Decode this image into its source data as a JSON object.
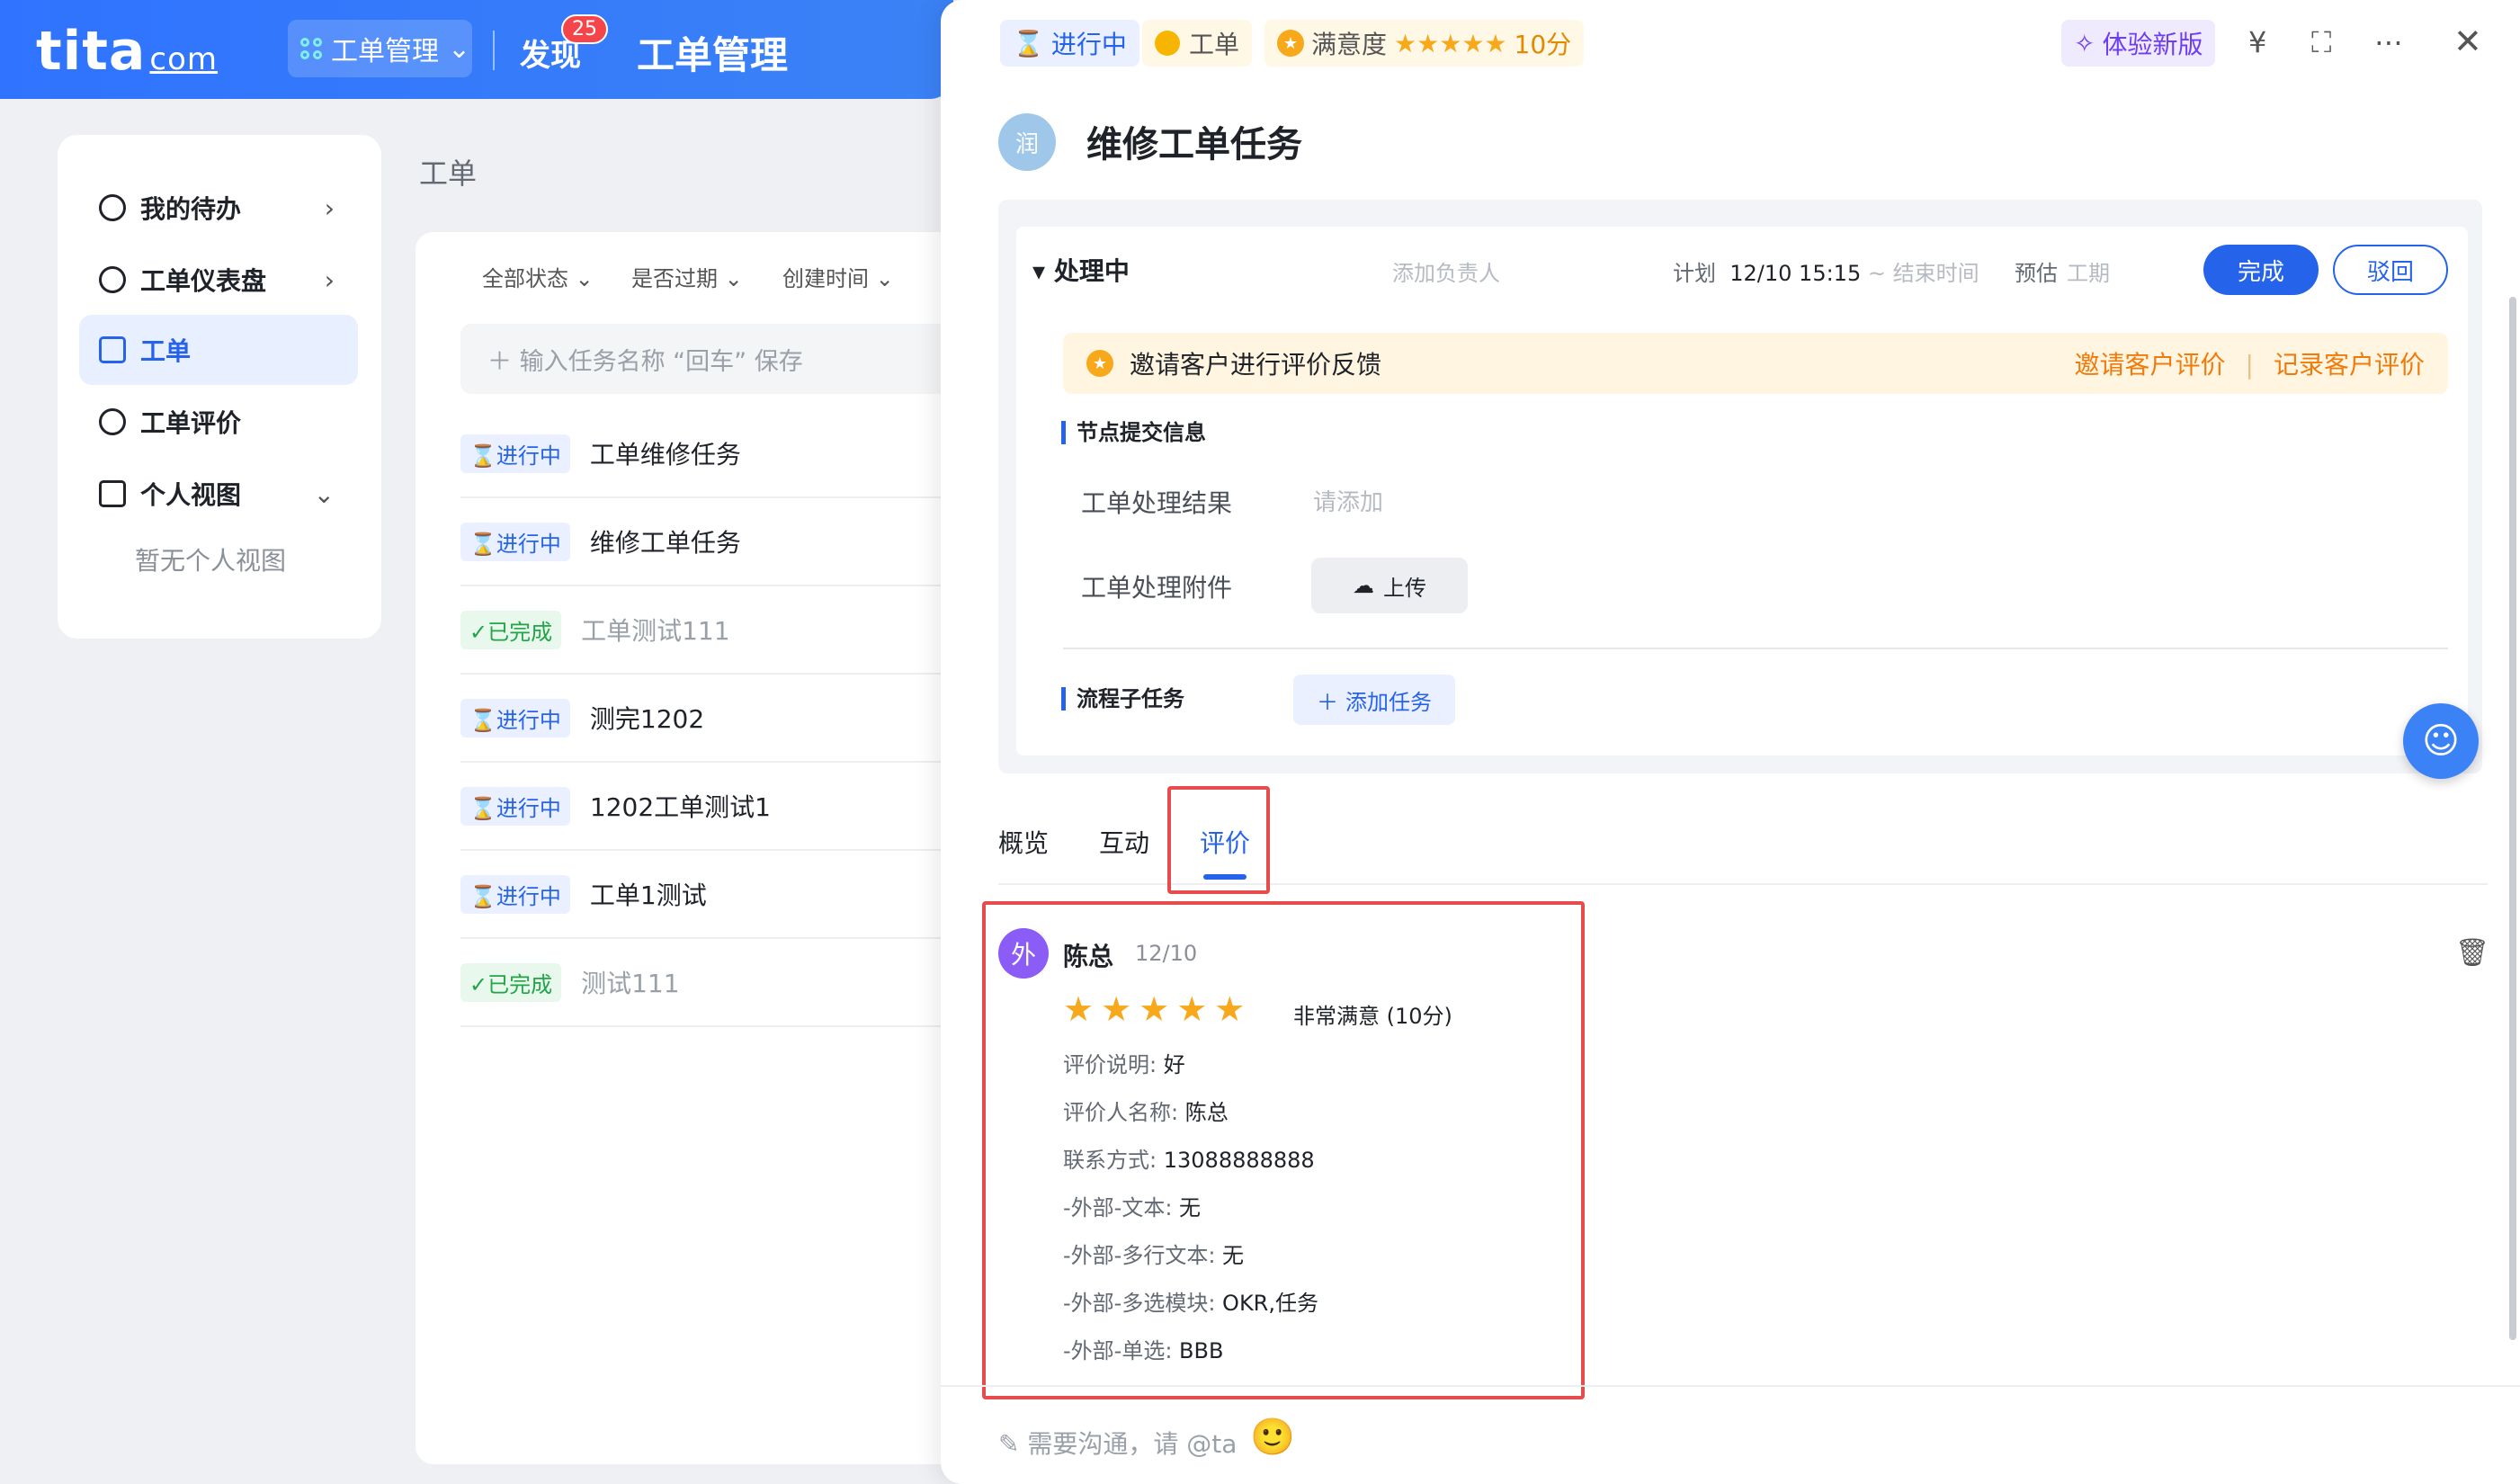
{
  "topbar": {
    "logo": "tita",
    "logo_suffix": "com",
    "module": "工单管理",
    "discover": "发现",
    "discover_badge": "25",
    "title": "工单管理"
  },
  "sidebar": {
    "items": [
      {
        "label": "我的待办",
        "icon": "check-circle-icon"
      },
      {
        "label": "工单仪表盘",
        "icon": "gauge-icon"
      },
      {
        "label": "工单",
        "icon": "document-icon"
      },
      {
        "label": "工单评价",
        "icon": "star-badge-icon"
      },
      {
        "label": "个人视图",
        "icon": "grid-icon"
      }
    ],
    "empty_view": "暂无个人视图"
  },
  "list": {
    "title": "工单",
    "filters": [
      "全部状态",
      "是否过期",
      "创建时间"
    ],
    "new_task_placeholder": "＋ 输入任务名称 “回车” 保存",
    "tasks": [
      {
        "status": "进行中",
        "name": "工单维修任务"
      },
      {
        "status": "进行中",
        "name": "维修工单任务"
      },
      {
        "status": "已完成",
        "name": "工单测试111"
      },
      {
        "status": "进行中",
        "name": "测完1202"
      },
      {
        "status": "进行中",
        "name": "1202工单测试1"
      },
      {
        "status": "进行中",
        "name": "工单1测试"
      },
      {
        "status": "已完成",
        "name": "测试111"
      }
    ]
  },
  "detail": {
    "status": "进行中",
    "type": "工单",
    "satisfaction_label": "满意度",
    "satisfaction_score": "10分",
    "satisfaction_stars": 5,
    "try_new": "体验新版",
    "avatar": "润",
    "title": "维修工单任务",
    "node": {
      "title": "处理中",
      "add_owner": "添加负责人",
      "plan_label": "计划",
      "plan_time": "12/10 15:15",
      "plan_end": "~ 结束时间",
      "estimate_label": "预估",
      "estimate_value": "工期",
      "btn_done": "完成",
      "btn_reject": "驳回",
      "invite_text": "邀请客户进行评价反馈",
      "invite_action": "邀请客户评价",
      "record_action": "记录客户评价",
      "section_submit": "节点提交信息",
      "field_result": "工单处理结果",
      "field_result_placeholder": "请添加",
      "field_attachment": "工单处理附件",
      "upload": "上传",
      "section_subtask": "流程子任务",
      "add_subtask": "添加任务"
    },
    "tabs": [
      "概览",
      "互动",
      "评价"
    ],
    "active_tab": "评价",
    "review": {
      "avatar": "外",
      "name": "陈总",
      "date": "12/10",
      "stars": 5,
      "level": "非常满意 (10分)",
      "fields": [
        {
          "label": "评价说明:",
          "value": "好"
        },
        {
          "label": "评价人名称:",
          "value": "陈总"
        },
        {
          "label": "联系方式:",
          "value": "13088888888"
        },
        {
          "label": "-外部-文本:",
          "value": "无"
        },
        {
          "label": "-外部-多行文本:",
          "value": "无"
        },
        {
          "label": "-外部-多选模块:",
          "value": "OKR,任务"
        },
        {
          "label": "-外部-单选:",
          "value": "BBB"
        }
      ]
    },
    "comment_placeholder": "需要沟通，请 @ta"
  }
}
